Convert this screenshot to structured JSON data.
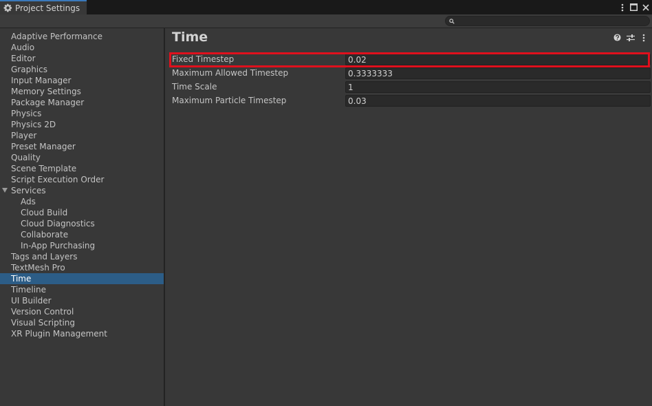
{
  "window": {
    "tab_title": "Project Settings",
    "tab_icon": "gear-icon",
    "controls": [
      "kebab-menu-icon",
      "maximize-icon",
      "close-icon"
    ]
  },
  "search": {
    "placeholder": "",
    "value": ""
  },
  "sidebar": {
    "items": [
      {
        "label": "Adaptive Performance",
        "level": 0
      },
      {
        "label": "Audio",
        "level": 0
      },
      {
        "label": "Editor",
        "level": 0
      },
      {
        "label": "Graphics",
        "level": 0
      },
      {
        "label": "Input Manager",
        "level": 0
      },
      {
        "label": "Memory Settings",
        "level": 0
      },
      {
        "label": "Package Manager",
        "level": 0
      },
      {
        "label": "Physics",
        "level": 0
      },
      {
        "label": "Physics 2D",
        "level": 0
      },
      {
        "label": "Player",
        "level": 0
      },
      {
        "label": "Preset Manager",
        "level": 0
      },
      {
        "label": "Quality",
        "level": 0
      },
      {
        "label": "Scene Template",
        "level": 0
      },
      {
        "label": "Script Execution Order",
        "level": 0
      },
      {
        "label": "Services",
        "level": 0,
        "expanded": true
      },
      {
        "label": "Ads",
        "level": 1
      },
      {
        "label": "Cloud Build",
        "level": 1
      },
      {
        "label": "Cloud Diagnostics",
        "level": 1
      },
      {
        "label": "Collaborate",
        "level": 1
      },
      {
        "label": "In-App Purchasing",
        "level": 1
      },
      {
        "label": "Tags and Layers",
        "level": 0
      },
      {
        "label": "TextMesh Pro",
        "level": 0
      },
      {
        "label": "Time",
        "level": 0,
        "selected": true
      },
      {
        "label": "Timeline",
        "level": 0
      },
      {
        "label": "UI Builder",
        "level": 0
      },
      {
        "label": "Version Control",
        "level": 0
      },
      {
        "label": "Visual Scripting",
        "level": 0
      },
      {
        "label": "XR Plugin Management",
        "level": 0
      }
    ]
  },
  "content": {
    "title": "Time",
    "header_icons": [
      "help-icon",
      "preset-sliders-icon",
      "kebab-menu-icon"
    ],
    "properties": [
      {
        "label": "Fixed Timestep",
        "value": "0.02",
        "highlighted": true
      },
      {
        "label": "Maximum Allowed Timestep",
        "value": "0.3333333"
      },
      {
        "label": "Time Scale",
        "value": "1"
      },
      {
        "label": "Maximum Particle Timestep",
        "value": "0.03"
      }
    ]
  },
  "colors": {
    "selection": "#2c5d87",
    "highlight": "#e0101d",
    "tab_accent": "#3a79bb",
    "panel_bg": "#383838"
  }
}
